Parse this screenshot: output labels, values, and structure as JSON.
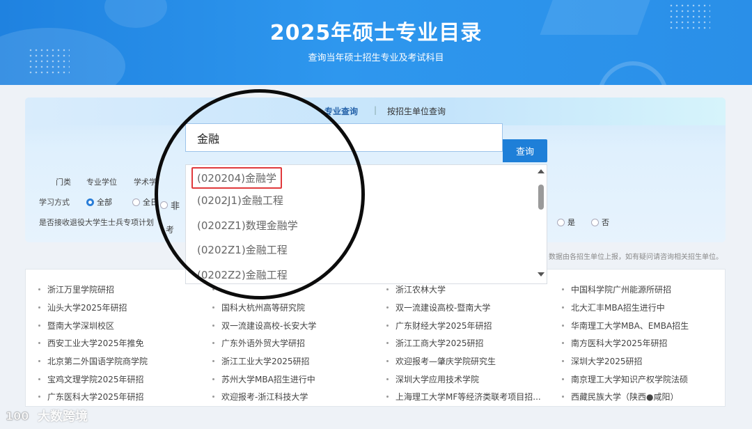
{
  "header": {
    "title": "2025年硕士专业目录",
    "subtitle": "查询当年硕士招生专业及考试科目"
  },
  "panel": {
    "tabs": [
      {
        "label": "专业查询",
        "active": true
      },
      {
        "label": "|"
      },
      {
        "label": "按招生单位查询"
      }
    ],
    "search": {
      "value": "金融",
      "button": "查询"
    },
    "filters": {
      "category_label": "门类",
      "category_options": [
        "专业学位",
        "学术学"
      ],
      "study_mode_label": "学习方式",
      "study_mode_options": [
        {
          "label": "全部",
          "selected": true
        },
        {
          "label": "全日"
        },
        {
          "label": "非"
        }
      ],
      "soldier_label": "是否接收退役大学生士兵专项计划",
      "partial_text": "考",
      "soldier_options": [
        {
          "label": "是"
        },
        {
          "label": "否"
        }
      ]
    },
    "note": "数据由各招生单位上报，如有疑问请咨询相关招生单位。"
  },
  "dropdown": {
    "items": [
      {
        "label": "(020204)金融学",
        "highlighted": true
      },
      {
        "label": "(0202J1)金融工程"
      },
      {
        "label": "(0202Z1)数理金融学"
      },
      {
        "label": "(0202Z1)金融工程"
      },
      {
        "label": "(0202Z2)金融工程"
      }
    ]
  },
  "links": {
    "columns": [
      [
        "浙江万里学院研招",
        "汕头大学2025年研招",
        "暨南大学深圳校区",
        "西安工业大学2025年推免",
        "北京第二外国语学院商学院",
        "宝鸡文理学院2025年研招",
        "广东医科大学2025年研招"
      ],
      [
        "",
        "国科大杭州高等研究院",
        "双一流建设高校-长安大学",
        "广东外语外贸大学研招",
        "浙江工业大学2025研招",
        "苏州大学MBA招生进行中",
        "欢迎报考-浙江科技大学"
      ],
      [
        "浙江农林大学",
        "双一流建设高校-暨南大学",
        "广东财经大学2025年研招",
        "浙江工商大学2025研招",
        "欢迎报考—肇庆学院研究生",
        "深圳大学应用技术学院",
        "上海理工大学MF等经济类联考项目招..."
      ],
      [
        "中国科学院广州能源所研招",
        "北大汇丰MBA招生进行中",
        "华南理工大学MBA、EMBA招生",
        "南方医科大学2025年研招",
        "深圳大学2025研招",
        "南京理工大学知识产权学院法硕",
        "西藏民族大学（陕西●咸阳）"
      ]
    ]
  },
  "watermark": {
    "text": "大数跨境"
  }
}
